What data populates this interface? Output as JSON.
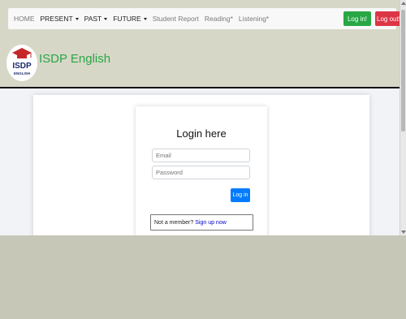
{
  "navbar": {
    "items": [
      {
        "label": "HOME",
        "dropdown": false,
        "strong": false
      },
      {
        "label": "PRESENT",
        "dropdown": true,
        "strong": true
      },
      {
        "label": "PAST",
        "dropdown": true,
        "strong": true
      },
      {
        "label": "FUTURE",
        "dropdown": true,
        "strong": true
      },
      {
        "label": "Student Report",
        "dropdown": false,
        "strong": false
      },
      {
        "label": "Reading*",
        "dropdown": false,
        "strong": false
      },
      {
        "label": "Listening*",
        "dropdown": false,
        "strong": false
      }
    ],
    "login_label": "Log in!",
    "logout_label": "Log out!"
  },
  "logo": {
    "text_top": "ISDP",
    "text_bottom": "ENGLISH"
  },
  "site_title": "ISDP English",
  "login": {
    "title": "Login here",
    "email_placeholder": "Email",
    "password_placeholder": "Password",
    "submit_label": "Log in",
    "member_text": "Not a member?",
    "signup_link": "Sign up now"
  },
  "colors": {
    "green": "#28a745",
    "red": "#dc3545",
    "blue": "#007bff",
    "logo_red": "#c62828",
    "logo_navy": "#1a2a6c"
  }
}
